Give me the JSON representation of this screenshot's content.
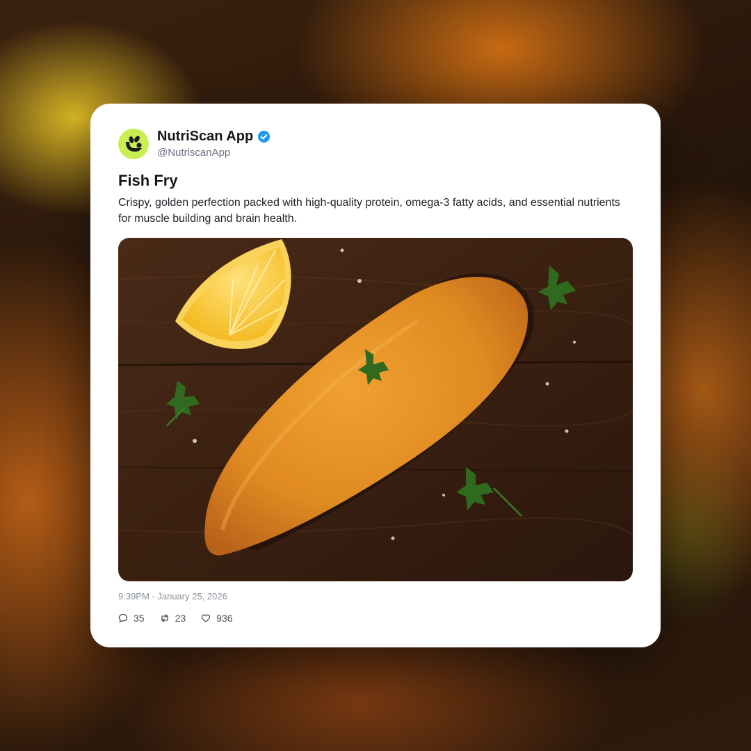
{
  "post": {
    "display_name": "NutriScan App",
    "handle": "@NutriscanApp",
    "verified": true,
    "title": "Fish Fry",
    "description": "Crispy, golden perfection packed with high-quality protein, omega-3 fatty acids, and essential nutrients for muscle building and brain health.",
    "timestamp": "9:39PM - January 25, 2026",
    "image_subject": "fried fish fillet with lemon wedge and parsley on wooden board"
  },
  "stats": {
    "comments": "35",
    "reposts": "23",
    "likes": "936"
  },
  "icons": {
    "avatar": "nutriscan-logo-icon",
    "verified": "verified-badge-icon",
    "comments": "comment-icon",
    "reposts": "repost-icon",
    "likes": "heart-icon"
  },
  "colors": {
    "avatar_bg": "#c8ee52",
    "verified": "#1d9bf0",
    "card_bg": "#ffffff"
  }
}
